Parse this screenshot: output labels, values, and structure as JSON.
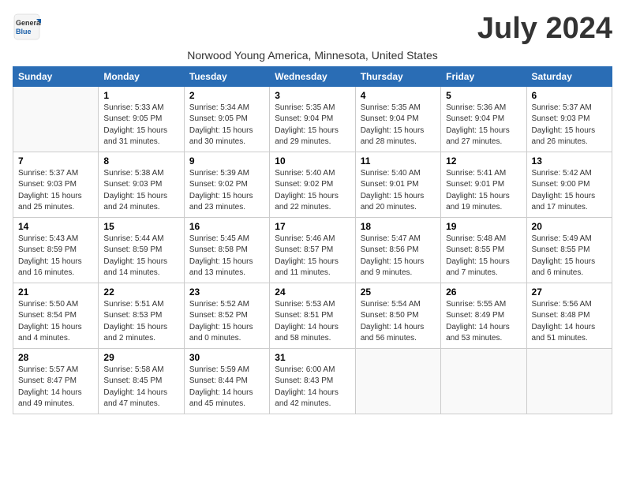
{
  "header": {
    "logo_general": "General",
    "logo_blue": "Blue",
    "month_title": "July 2024",
    "subtitle": "Norwood Young America, Minnesota, United States"
  },
  "days_of_week": [
    "Sunday",
    "Monday",
    "Tuesday",
    "Wednesday",
    "Thursday",
    "Friday",
    "Saturday"
  ],
  "weeks": [
    [
      {
        "num": "",
        "info": ""
      },
      {
        "num": "1",
        "info": "Sunrise: 5:33 AM\nSunset: 9:05 PM\nDaylight: 15 hours\nand 31 minutes."
      },
      {
        "num": "2",
        "info": "Sunrise: 5:34 AM\nSunset: 9:05 PM\nDaylight: 15 hours\nand 30 minutes."
      },
      {
        "num": "3",
        "info": "Sunrise: 5:35 AM\nSunset: 9:04 PM\nDaylight: 15 hours\nand 29 minutes."
      },
      {
        "num": "4",
        "info": "Sunrise: 5:35 AM\nSunset: 9:04 PM\nDaylight: 15 hours\nand 28 minutes."
      },
      {
        "num": "5",
        "info": "Sunrise: 5:36 AM\nSunset: 9:04 PM\nDaylight: 15 hours\nand 27 minutes."
      },
      {
        "num": "6",
        "info": "Sunrise: 5:37 AM\nSunset: 9:03 PM\nDaylight: 15 hours\nand 26 minutes."
      }
    ],
    [
      {
        "num": "7",
        "info": "Sunrise: 5:37 AM\nSunset: 9:03 PM\nDaylight: 15 hours\nand 25 minutes."
      },
      {
        "num": "8",
        "info": "Sunrise: 5:38 AM\nSunset: 9:03 PM\nDaylight: 15 hours\nand 24 minutes."
      },
      {
        "num": "9",
        "info": "Sunrise: 5:39 AM\nSunset: 9:02 PM\nDaylight: 15 hours\nand 23 minutes."
      },
      {
        "num": "10",
        "info": "Sunrise: 5:40 AM\nSunset: 9:02 PM\nDaylight: 15 hours\nand 22 minutes."
      },
      {
        "num": "11",
        "info": "Sunrise: 5:40 AM\nSunset: 9:01 PM\nDaylight: 15 hours\nand 20 minutes."
      },
      {
        "num": "12",
        "info": "Sunrise: 5:41 AM\nSunset: 9:01 PM\nDaylight: 15 hours\nand 19 minutes."
      },
      {
        "num": "13",
        "info": "Sunrise: 5:42 AM\nSunset: 9:00 PM\nDaylight: 15 hours\nand 17 minutes."
      }
    ],
    [
      {
        "num": "14",
        "info": "Sunrise: 5:43 AM\nSunset: 8:59 PM\nDaylight: 15 hours\nand 16 minutes."
      },
      {
        "num": "15",
        "info": "Sunrise: 5:44 AM\nSunset: 8:59 PM\nDaylight: 15 hours\nand 14 minutes."
      },
      {
        "num": "16",
        "info": "Sunrise: 5:45 AM\nSunset: 8:58 PM\nDaylight: 15 hours\nand 13 minutes."
      },
      {
        "num": "17",
        "info": "Sunrise: 5:46 AM\nSunset: 8:57 PM\nDaylight: 15 hours\nand 11 minutes."
      },
      {
        "num": "18",
        "info": "Sunrise: 5:47 AM\nSunset: 8:56 PM\nDaylight: 15 hours\nand 9 minutes."
      },
      {
        "num": "19",
        "info": "Sunrise: 5:48 AM\nSunset: 8:55 PM\nDaylight: 15 hours\nand 7 minutes."
      },
      {
        "num": "20",
        "info": "Sunrise: 5:49 AM\nSunset: 8:55 PM\nDaylight: 15 hours\nand 6 minutes."
      }
    ],
    [
      {
        "num": "21",
        "info": "Sunrise: 5:50 AM\nSunset: 8:54 PM\nDaylight: 15 hours\nand 4 minutes."
      },
      {
        "num": "22",
        "info": "Sunrise: 5:51 AM\nSunset: 8:53 PM\nDaylight: 15 hours\nand 2 minutes."
      },
      {
        "num": "23",
        "info": "Sunrise: 5:52 AM\nSunset: 8:52 PM\nDaylight: 15 hours\nand 0 minutes."
      },
      {
        "num": "24",
        "info": "Sunrise: 5:53 AM\nSunset: 8:51 PM\nDaylight: 14 hours\nand 58 minutes."
      },
      {
        "num": "25",
        "info": "Sunrise: 5:54 AM\nSunset: 8:50 PM\nDaylight: 14 hours\nand 56 minutes."
      },
      {
        "num": "26",
        "info": "Sunrise: 5:55 AM\nSunset: 8:49 PM\nDaylight: 14 hours\nand 53 minutes."
      },
      {
        "num": "27",
        "info": "Sunrise: 5:56 AM\nSunset: 8:48 PM\nDaylight: 14 hours\nand 51 minutes."
      }
    ],
    [
      {
        "num": "28",
        "info": "Sunrise: 5:57 AM\nSunset: 8:47 PM\nDaylight: 14 hours\nand 49 minutes."
      },
      {
        "num": "29",
        "info": "Sunrise: 5:58 AM\nSunset: 8:45 PM\nDaylight: 14 hours\nand 47 minutes."
      },
      {
        "num": "30",
        "info": "Sunrise: 5:59 AM\nSunset: 8:44 PM\nDaylight: 14 hours\nand 45 minutes."
      },
      {
        "num": "31",
        "info": "Sunrise: 6:00 AM\nSunset: 8:43 PM\nDaylight: 14 hours\nand 42 minutes."
      },
      {
        "num": "",
        "info": ""
      },
      {
        "num": "",
        "info": ""
      },
      {
        "num": "",
        "info": ""
      }
    ]
  ]
}
